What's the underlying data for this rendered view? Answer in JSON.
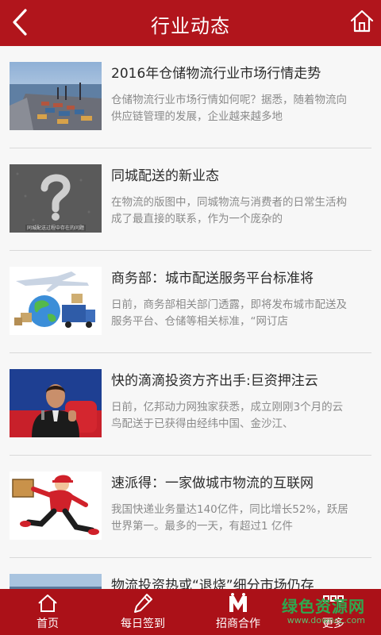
{
  "header": {
    "title": "行业动态",
    "back_icon": "chevron-left-icon",
    "home_icon": "home-icon"
  },
  "articles": [
    {
      "title": "2016年仓储物流行业市场行情走势",
      "summary": "仓储物流行业市场行情如何呢？据悉，随着物流向供应链管理的发展，企业越来越多地",
      "image": "port-containers-image"
    },
    {
      "title": "同城配送的新业态",
      "summary": "在物流的版图中，同城物流与消费者的日常生活构成了最直接的联系，作为一个庞杂的",
      "image": "question-mark-image",
      "image_caption": "同城配送过程中存在的问题"
    },
    {
      "title": "商务部：城市配送服务平台标准将",
      "summary": "日前，商务部相关部门透露，即将发布城市配送及服务平台、仓储等相关标准，“网订店",
      "image": "logistics-globe-image"
    },
    {
      "title": "快的滴滴投资方齐出手:巨资押注云",
      "summary": "日前，亿邦动力网独家获悉，成立刚刚3个月的云鸟配送于已获得由经纬中国、金沙江、",
      "image": "speaker-portrait-image"
    },
    {
      "title": "速派得：一家做城市物流的互联网",
      "summary": "我国快递业务量达140亿件，同比增长52%，跃居世界第一。最多的一天，有超过1 亿件",
      "image": "courier-running-image"
    },
    {
      "title": "物流投资热或“退烧”细分市场仍存",
      "summary": "",
      "image": "cargo-image"
    }
  ],
  "tabbar": {
    "items": [
      {
        "label": "首页",
        "icon": "home-icon"
      },
      {
        "label": "每日签到",
        "icon": "pen-icon"
      },
      {
        "label": "招商合作",
        "icon": "m-logo-icon"
      },
      {
        "label": "更多",
        "icon": "grid-icon"
      }
    ]
  },
  "watermark": {
    "line1": "绿色资源网",
    "line2": "www.downcc.com"
  },
  "colors": {
    "brand_red": "#b1151c",
    "title_text": "#2b2b2b",
    "summary_text": "#8a8a8a"
  }
}
